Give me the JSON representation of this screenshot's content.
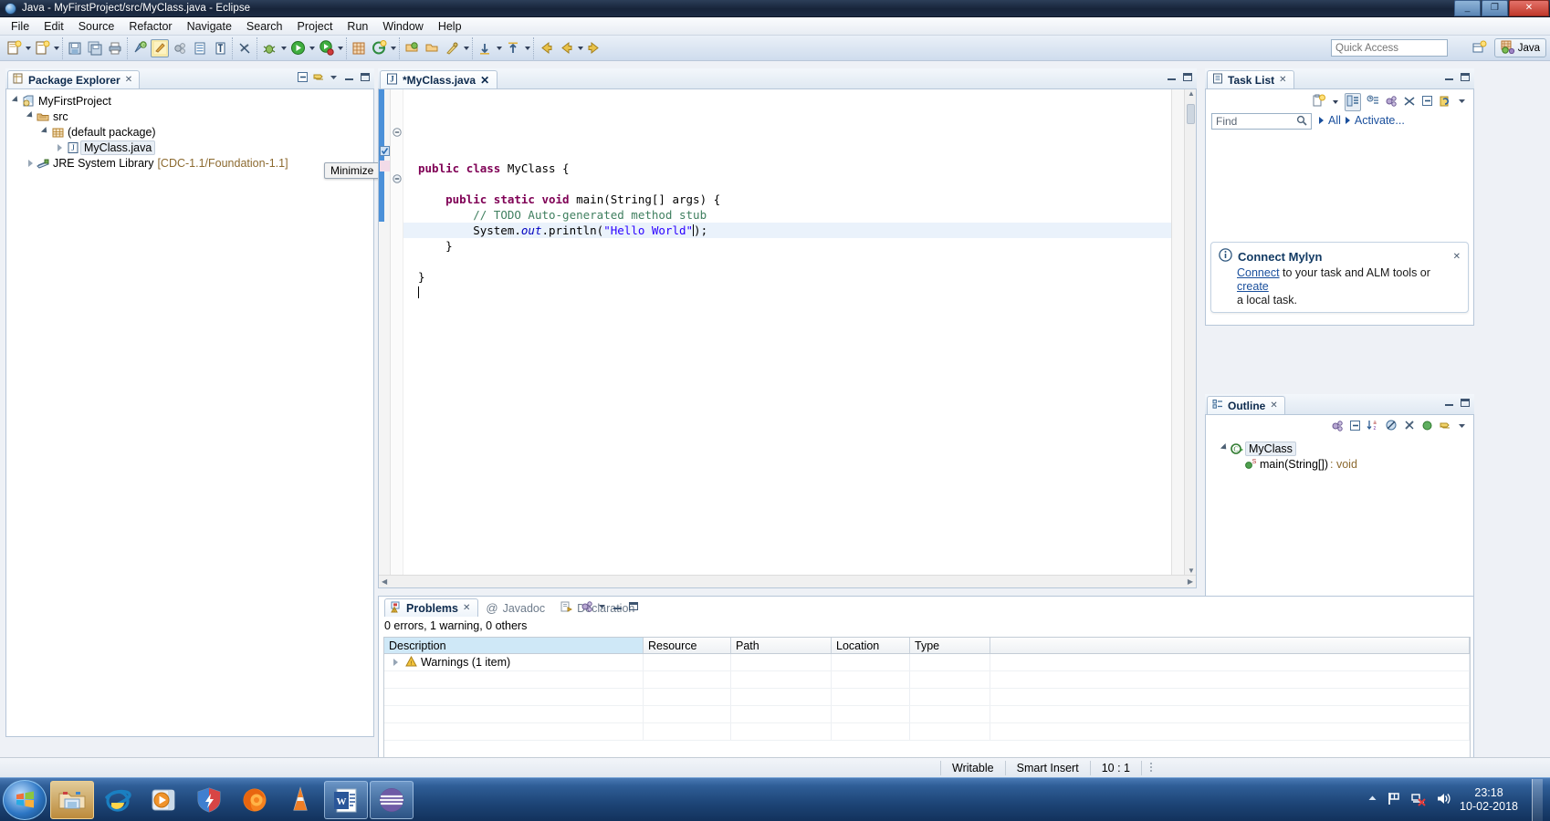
{
  "window": {
    "title": "Java - MyFirstProject/src/MyClass.java - Eclipse",
    "minimize_label": "_",
    "maximize_label": "❐",
    "close_label": "✕"
  },
  "menu": {
    "items": [
      "File",
      "Edit",
      "Source",
      "Refactor",
      "Navigate",
      "Search",
      "Project",
      "Run",
      "Window",
      "Help"
    ]
  },
  "toolbar": {
    "quick_access_placeholder": "Quick Access",
    "perspective_label": "Java",
    "open_perspective_icon": "open-perspective-icon",
    "groups": [
      {
        "icons": [
          "new-wizard-icon",
          "dropdown-arrow",
          "new-java-class-icon",
          "dropdown-arrow"
        ]
      },
      {
        "icons": [
          "save-icon",
          "save-all-icon",
          "print-icon"
        ]
      },
      {
        "icons": [
          "build-all-icon",
          "toggle-mark-occurrences-icon",
          "skip-all-breakpoints-icon",
          "open-task-icon",
          "show-whitespace-icon"
        ]
      },
      {
        "icons": [
          "link-with-editor-icon"
        ]
      },
      {
        "icons": [
          "debug-icon",
          "dropdown-arrow",
          "run-icon",
          "dropdown-arrow",
          "coverage-icon",
          "dropdown-arrow"
        ]
      },
      {
        "icons": [
          "new-java-project-icon",
          "new-package-icon",
          "dropdown-arrow"
        ]
      },
      {
        "icons": [
          "open-type-icon",
          "open-task-repository-icon",
          "search-icon",
          "dropdown-arrow"
        ]
      },
      {
        "icons": [
          "next-annotation-icon",
          "dropdown-arrow",
          "previous-annotation-icon",
          "dropdown-arrow"
        ]
      },
      {
        "icons": [
          "back-icon",
          "forward-icon",
          "dropdown-arrow",
          "forward-arrow-icon"
        ]
      }
    ]
  },
  "package_explorer": {
    "tab_label": "Package Explorer",
    "close_glyph": "✕",
    "toolbar_icons": [
      "collapse-all-icon",
      "link-with-editor-icon",
      "view-menu-icon",
      "minimize-icon",
      "maximize-icon"
    ],
    "tooltip": "Minimize",
    "tree": [
      {
        "label": "MyFirstProject",
        "icon": "java-project-icon",
        "indent": 0,
        "twisty": "expanded",
        "suffix": ""
      },
      {
        "label": "src",
        "icon": "source-folder-icon",
        "indent": 1,
        "twisty": "expanded",
        "suffix": ""
      },
      {
        "label": "(default package)",
        "icon": "package-icon",
        "indent": 2,
        "twisty": "expanded",
        "suffix": ""
      },
      {
        "label": "MyClass.java",
        "icon": "java-file-icon",
        "indent": 3,
        "twisty": "collapsed",
        "suffix": "",
        "selected": true
      },
      {
        "label": "JRE System Library",
        "icon": "library-icon",
        "indent": 1,
        "twisty": "collapsed",
        "suffix": "[CDC-1.1/Foundation-1.1]"
      }
    ]
  },
  "editor": {
    "tab_label": "*MyClass.java",
    "tab_icon": "java-file-icon",
    "close_glyph": "✕",
    "code_lines": [
      "public class MyClass {",
      "",
      "    public static void main(String[] args) {",
      "        // TODO Auto-generated method stub",
      "        System.out.println(\"Hello World\");",
      "    }",
      "",
      "}",
      ""
    ],
    "fold_markers": [
      "collapse-marker",
      "collapse-marker"
    ],
    "marker_icons": [
      "warning-marker-icon"
    ]
  },
  "task_list": {
    "tab_label": "Task List",
    "close_glyph": "✕",
    "toolbar_icons": [
      "new-task-icon",
      "dropdown-arrow",
      "categorized-presentation-icon",
      "scheduled-presentation-icon",
      "focus-on-workweek-icon",
      "collapse-all-icon",
      "restore-icon",
      "synchronize-icon",
      "view-menu-icon"
    ],
    "find_placeholder": "Find",
    "find_icon": "search-icon",
    "filters": [
      "All",
      "Activate..."
    ]
  },
  "mylyn": {
    "title": "Connect Mylyn",
    "info_icon": "info-icon",
    "close_glyph": "✕",
    "link1": "Connect",
    "text1": " to your task and ALM tools or ",
    "link2": "create",
    "text2": "a local task."
  },
  "outline": {
    "tab_label": "Outline",
    "close_glyph": "✕",
    "toolbar_icons": [
      "focus-on-active-task-icon",
      "collapse-all-icon",
      "sort-icon",
      "hide-fields-icon",
      "hide-static-icon",
      "hide-non-public-icon",
      "link-with-editor-icon",
      "view-menu-icon"
    ],
    "tree": [
      {
        "label": "MyClass",
        "icon": "class-icon",
        "indent": 0,
        "twisty": "expanded",
        "selected": true,
        "type": ""
      },
      {
        "label": "main(String[])",
        "icon": "public-method-icon",
        "indent": 1,
        "twisty": "none",
        "selected": false,
        "type": " : void",
        "modifier": "S"
      }
    ]
  },
  "problems": {
    "tabs": [
      {
        "label": "Problems",
        "icon": "problems-icon",
        "active": true,
        "close_glyph": "✕"
      },
      {
        "label": "Javadoc",
        "icon": "javadoc-icon",
        "active": false
      },
      {
        "label": "Declaration",
        "icon": "declaration-icon",
        "active": false
      }
    ],
    "summary": "0 errors, 1 warning, 0 others",
    "toolbar_icons": [
      "focus-on-active-task-icon",
      "view-menu-icon",
      "minimize-icon",
      "maximize-icon"
    ],
    "columns": [
      "Description",
      "Resource",
      "Path",
      "Location",
      "Type"
    ],
    "rows": [
      {
        "description": "Warnings (1 item)",
        "icon": "warning-icon",
        "twisty": "collapsed",
        "resource": "",
        "path": "",
        "location": "",
        "type": ""
      },
      {
        "description": "",
        "icon": "",
        "twisty": "none",
        "resource": "",
        "path": "",
        "location": "",
        "type": ""
      },
      {
        "description": "",
        "icon": "",
        "twisty": "none",
        "resource": "",
        "path": "",
        "location": "",
        "type": ""
      },
      {
        "description": "",
        "icon": "",
        "twisty": "none",
        "resource": "",
        "path": "",
        "location": "",
        "type": ""
      },
      {
        "description": "",
        "icon": "",
        "twisty": "none",
        "resource": "",
        "path": "",
        "location": "",
        "type": ""
      }
    ]
  },
  "status_bar": {
    "writable": "Writable",
    "insert_mode": "Smart Insert",
    "position": "10 : 1"
  },
  "taskbar": {
    "start_icon": "windows-start-icon",
    "items": [
      {
        "name": "windows-explorer-icon",
        "pinned": true
      },
      {
        "name": "internet-explorer-icon",
        "pinned": false
      },
      {
        "name": "media-player-icon",
        "pinned": false
      },
      {
        "name": "security-shield-icon",
        "pinned": false
      },
      {
        "name": "firefox-icon",
        "pinned": false
      },
      {
        "name": "vlc-cone-icon",
        "pinned": false
      },
      {
        "name": "word-icon",
        "running": true
      },
      {
        "name": "eclipse-icon",
        "running": true
      }
    ],
    "tray": [
      "show-hidden-icons-arrow",
      "action-center-flag-icon",
      "network-disconnected-icon",
      "volume-icon"
    ],
    "time": "23:18",
    "date": "10-02-2018"
  },
  "colors": {
    "accent": "#1a4f9c",
    "keyword": "#7f0055",
    "string": "#2a00ff",
    "comment": "#3f7f5f",
    "title_bar": "#1d2c44"
  }
}
